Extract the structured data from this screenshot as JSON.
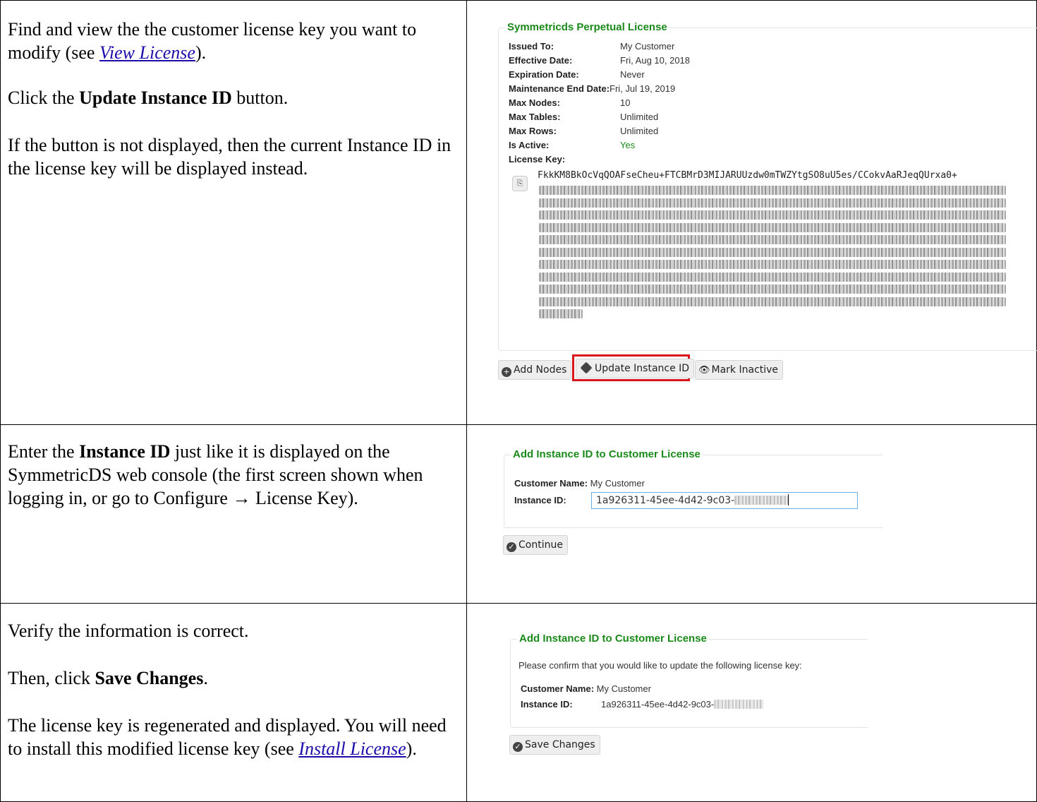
{
  "row1": {
    "p1_before": "Find and view the the customer license key you want to modify (see ",
    "p1_link": "View License",
    "p1_after": ").",
    "p2_before": "Click the ",
    "p2_bold": "Update Instance ID",
    "p2_after": " button.",
    "p3": "If the button is not displayed, then the current Instance ID in the license key will be displayed instead.",
    "screen": {
      "legend": "Symmetricds Perpetual License",
      "fields": [
        {
          "label": "Issued To:",
          "value": "My Customer"
        },
        {
          "label": "Effective Date:",
          "value": "Fri, Aug 10, 2018"
        },
        {
          "label": "Expiration Date:",
          "value": "Never"
        },
        {
          "label": "Maintenance End Date:",
          "value": "Fri, Jul 19, 2019"
        },
        {
          "label": "Max Nodes:",
          "value": "10"
        },
        {
          "label": "Max Tables:",
          "value": "Unlimited"
        },
        {
          "label": "Max Rows:",
          "value": "Unlimited"
        },
        {
          "label": "Is Active:",
          "value": "Yes"
        }
      ],
      "license_key_label": "License Key:",
      "license_key_visible": "FkkKM8BkOcVqQOAFseCheu+FTCBMrD3MIJARUUzdw0mTWZYtgSO8uU5es/CCokvAaRJeqQUrxa0+",
      "buttons": {
        "add_nodes": "Add Nodes",
        "update_instance": "Update Instance ID",
        "mark_inactive": "Mark Inactive"
      },
      "highlight_color": "#d9141c",
      "active_color": "#1b8a1b"
    }
  },
  "row2": {
    "p1_before": "Enter the ",
    "p1_bold": "Instance ID",
    "p1_after": " just like it is displayed on the SymmetricDS web console (the first screen shown when logging in, or go to Configure → License Key).",
    "screen": {
      "legend": "Add Instance ID to Customer License",
      "customer_label": "Customer Name:",
      "customer_value": "My Customer",
      "instance_label": "Instance ID:",
      "instance_value": "1a926311-45ee-4d42-9c03-",
      "continue": "Continue"
    }
  },
  "row3": {
    "p1": "Verify the information is correct.",
    "p2_before": "Then, click ",
    "p2_bold": "Save Changes",
    "p2_after": ".",
    "p3_before": "The license key is regenerated and displayed.  You will need to install this modified license key (see ",
    "p3_link": "Install License",
    "p3_after": ").",
    "screen": {
      "legend": "Add Instance ID to Customer License",
      "confirm": "Please confirm that you would like to update the following license key:",
      "customer_label": "Customer Name:",
      "customer_value": "My Customer",
      "instance_label": "Instance ID:",
      "instance_value": "1a926311-45ee-4d42-9c03-",
      "save": "Save Changes"
    }
  }
}
